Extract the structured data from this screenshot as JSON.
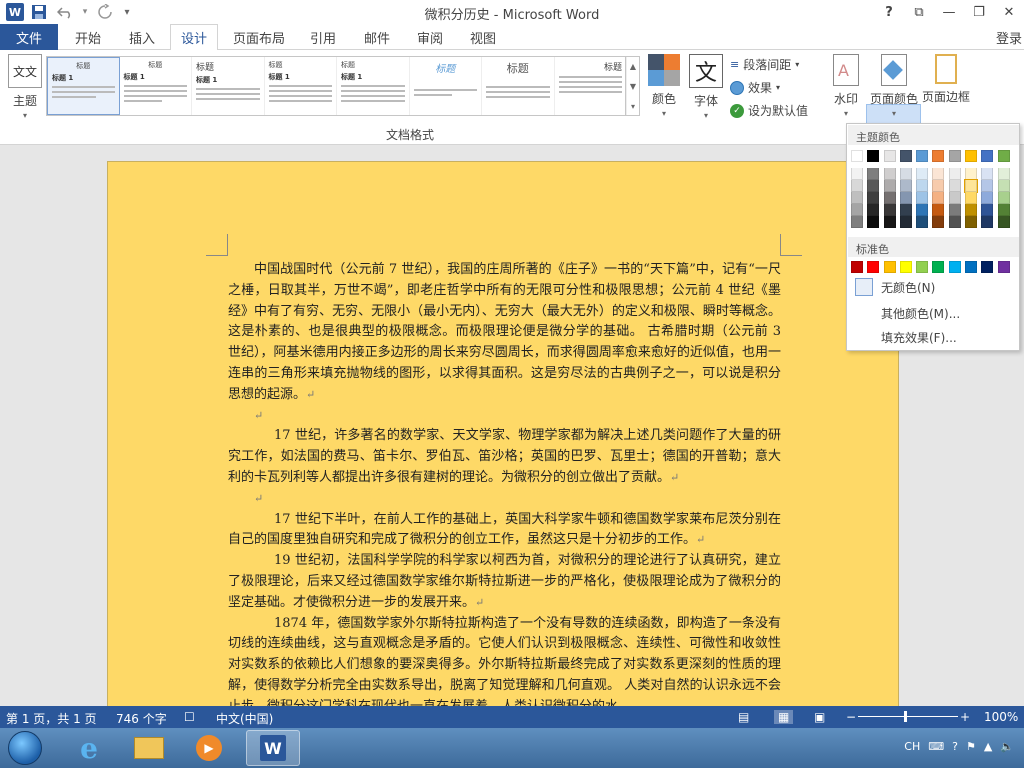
{
  "window": {
    "title": "微积分历史 - Microsoft Word",
    "controls": {
      "help": "?",
      "restore": "⧉",
      "minimize": "—",
      "maximize": "❐",
      "close": "✕"
    }
  },
  "quick_access": {
    "save_icon": "save-icon",
    "undo_icon": "undo-icon",
    "redo_icon": "redo-icon",
    "customize": "▾"
  },
  "tabs": {
    "file": "文件",
    "items": [
      "开始",
      "插入",
      "设计",
      "页面布局",
      "引用",
      "邮件",
      "审阅",
      "视图"
    ],
    "active": "设计",
    "signin": "登录"
  },
  "ribbon": {
    "theme_label": "主题",
    "theme_icon_text": "文文",
    "styles": [
      {
        "title": "标题",
        "heading": "标题 1"
      },
      {
        "title": "标题",
        "heading": "标题 1"
      },
      {
        "title": "标题",
        "heading": "标题 1"
      },
      {
        "title": "标题",
        "heading": "标题 1"
      },
      {
        "title": "标题",
        "heading": "标题 1"
      },
      {
        "title": "标题",
        "heading": ""
      },
      {
        "title": "标题",
        "heading": ""
      },
      {
        "title": "标题",
        "heading": ""
      }
    ],
    "group_label": "文档格式",
    "colors_label": "颜色",
    "fonts_label": "字体",
    "fonts_icon_text": "文",
    "paragraph_spacing": "段落间距",
    "effects": "效果",
    "set_default": "设为默认值",
    "watermark": "水印",
    "page_color": "页面颜色",
    "page_border": "页面边框"
  },
  "color_panel": {
    "theme_colors_label": "主题颜色",
    "standard_colors_label": "标准色",
    "theme_colors": [
      [
        "#ffffff",
        "#f2f2f2",
        "#d8d8d8",
        "#bfbfbf",
        "#a5a5a5",
        "#7f7f7f"
      ],
      [
        "#000000",
        "#7f7f7f",
        "#595959",
        "#3f3f3f",
        "#262626",
        "#0c0c0c"
      ],
      [
        "#e7e6e6",
        "#d0cece",
        "#aeabab",
        "#757070",
        "#3a3838",
        "#171616"
      ],
      [
        "#44546a",
        "#d6dce4",
        "#adb9ca",
        "#8496b0",
        "#323f4f",
        "#222a35"
      ],
      [
        "#5b9bd5",
        "#deebf6",
        "#bdd7ee",
        "#9dc3e6",
        "#2e75b5",
        "#1e4e79"
      ],
      [
        "#ed7d31",
        "#fbe5d5",
        "#f7cbac",
        "#f4b183",
        "#c55a11",
        "#833c0b"
      ],
      [
        "#a5a5a5",
        "#ededed",
        "#dbdbdb",
        "#c9c9c9",
        "#7b7b7b",
        "#525252"
      ],
      [
        "#ffc000",
        "#fff2cc",
        "#fee599",
        "#ffd965",
        "#bf9000",
        "#7f6000"
      ],
      [
        "#4472c4",
        "#d9e2f3",
        "#b4c6e7",
        "#8eaadb",
        "#2f5496",
        "#1f3864"
      ],
      [
        "#70ad47",
        "#e2efd9",
        "#c5e0b3",
        "#a8d08d",
        "#538135",
        "#375623"
      ]
    ],
    "selected_theme_color": "#fee599",
    "standard_colors": [
      "#c00000",
      "#ff0000",
      "#ffc000",
      "#ffff00",
      "#92d050",
      "#00b050",
      "#00b0f0",
      "#0070c0",
      "#002060",
      "#7030a0"
    ],
    "no_color": "无颜色(N)",
    "more_colors": "其他颜色(M)...",
    "fill_effects": "填充效果(F)..."
  },
  "page": {
    "background": "#fed967",
    "paragraphs": [
      {
        "text": "中国战国时代（公元前 7 世纪），我国的庄周所著的《庄子》一书的“天下篇”中，记有“一尺之棰，日取其半，万世不竭”，即老庄哲学中所有的无限可分性和极限思想；公元前 4 世纪《墨经》中有了有穷、无穷、无限小（最小无内）、无穷大（最大无外）的定义和极限、瞬时等概念。这是朴素的、也是很典型的极限概念。而极限理论便是微分学的基础。    古希腊时期（公元前 3 世纪），阿基米德用内接正多边形的周长来穷尽圆周长，而求得圆周率愈来愈好的近似值，也用一连串的三角形来填充抛物线的图形，以求得其面积。这是穷尽法的古典例子之一，可以说是积分思想的起源。",
        "style": "normal"
      },
      {
        "text": "",
        "style": "empty"
      },
      {
        "text": "17 世纪，许多著名的数学家、天文学家、物理学家都为解决上述几类问题作了大量的研究工作，如法国的费马、笛卡尔、罗伯瓦、笛沙格；英国的巴罗、瓦里士；德国的开普勒；意大利的卡瓦列利等人都提出许多很有建树的理论。为微积分的创立做出了贡献。",
        "style": "indent2"
      },
      {
        "text": "",
        "style": "empty"
      },
      {
        "text": "17 世纪下半叶，在前人工作的基础上，英国大科学家牛顿和德国数学家莱布尼茨分别在自己的国度里独自研究和完成了微积分的创立工作，虽然这只是十分初步的工作。",
        "style": "indent2"
      },
      {
        "text": "19 世纪初，法国科学学院的科学家以柯西为首，对微积分的理论进行了认真研究，建立了极限理论，后来又经过德国数学家维尔斯特拉斯进一步的严格化，使极限理论成为了微积分的坚定基础。才使微积分进一步的发展开来。",
        "style": "indent2"
      },
      {
        "text": "1874 年，德国数学家外尔斯特拉斯构造了一个没有导数的连续函数，即构造了一条没有切线的连续曲线，这与直观概念是矛盾的。它使人们认识到极限概念、连续性、可微性和收敛性对实数系的依赖比人们想象的要深奥得多。外尔斯特拉斯最终完成了对实数系更深刻的性质的理解，使得数学分析完全由实数系导出，脱离了知觉理解和几何直观。    人类对自然的认识永远不会止步，微积分这门学科在现代也一直在发展着。人类认识微积分的水",
        "style": "indent2"
      }
    ],
    "para_mark": "↵"
  },
  "status": {
    "page": "第 1 页，共 1 页",
    "words": "746 个字",
    "language": "中文(中国)",
    "zoom": "100%"
  },
  "tray": {
    "lang": "CH"
  }
}
